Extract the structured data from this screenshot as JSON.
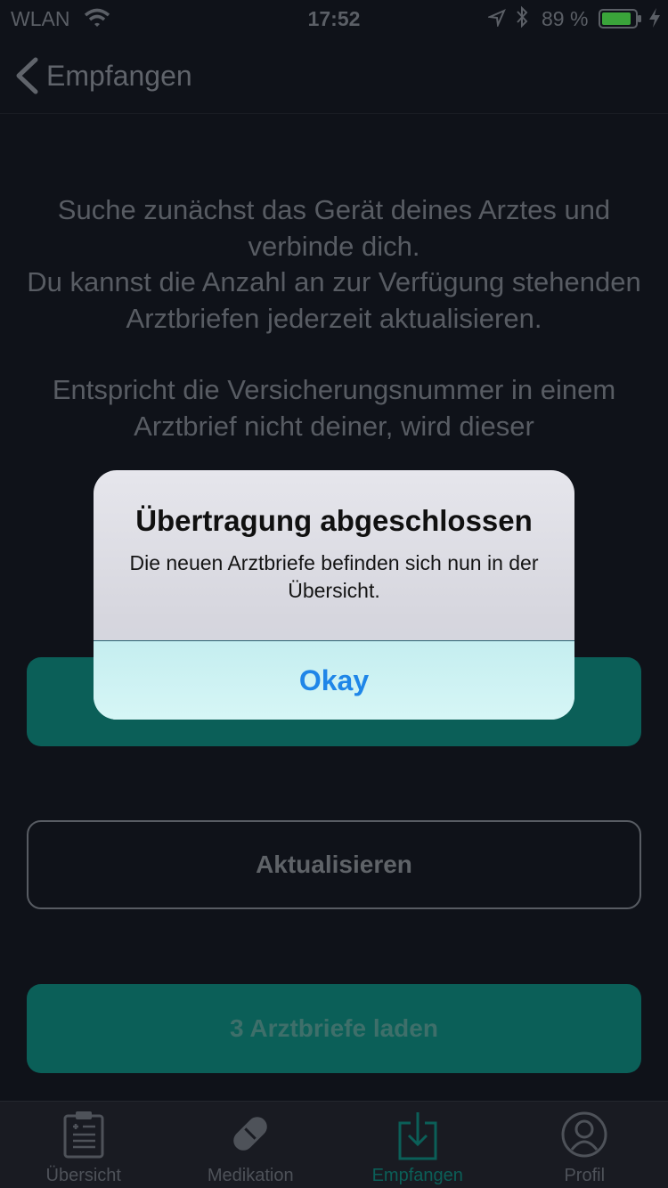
{
  "status_bar": {
    "carrier": "WLAN",
    "time": "17:52",
    "battery_percent": "89 %",
    "battery_level": 0.89,
    "icons": [
      "wifi-icon",
      "location-arrow-icon",
      "bluetooth-icon",
      "battery-icon",
      "charging-bolt-icon"
    ]
  },
  "nav": {
    "back_label": "Empfangen",
    "back_icon": "chevron-left-icon"
  },
  "content": {
    "paragraph1": "Suche zunächst das Gerät deines Arztes und verbinde dich.",
    "paragraph2": "Du kannst die Anzahl an zur Verfügung stehenden Arztbriefen jederzeit aktualisieren.",
    "paragraph3": "Entspricht die Versicherungsnummer in einem Arztbrief nicht deiner, wird dieser"
  },
  "buttons": {
    "refresh": "Aktualisieren",
    "load": "3 Arztbriefe laden"
  },
  "tabs": [
    {
      "label": "Übersicht",
      "icon": "clipboard-icon",
      "active": false
    },
    {
      "label": "Medikation",
      "icon": "pill-icon",
      "active": false
    },
    {
      "label": "Empfangen",
      "icon": "download-tray-icon",
      "active": true
    },
    {
      "label": "Profil",
      "icon": "profile-icon",
      "active": false
    }
  ],
  "alert": {
    "title": "Übertragung abgeschlossen",
    "message": "Die neuen Arztbriefe befinden sich nun in der Übersicht.",
    "action": "Okay"
  },
  "colors": {
    "background": "#0f1219",
    "accent_teal": "#0b5f58",
    "alert_action": "#1f86e8"
  }
}
